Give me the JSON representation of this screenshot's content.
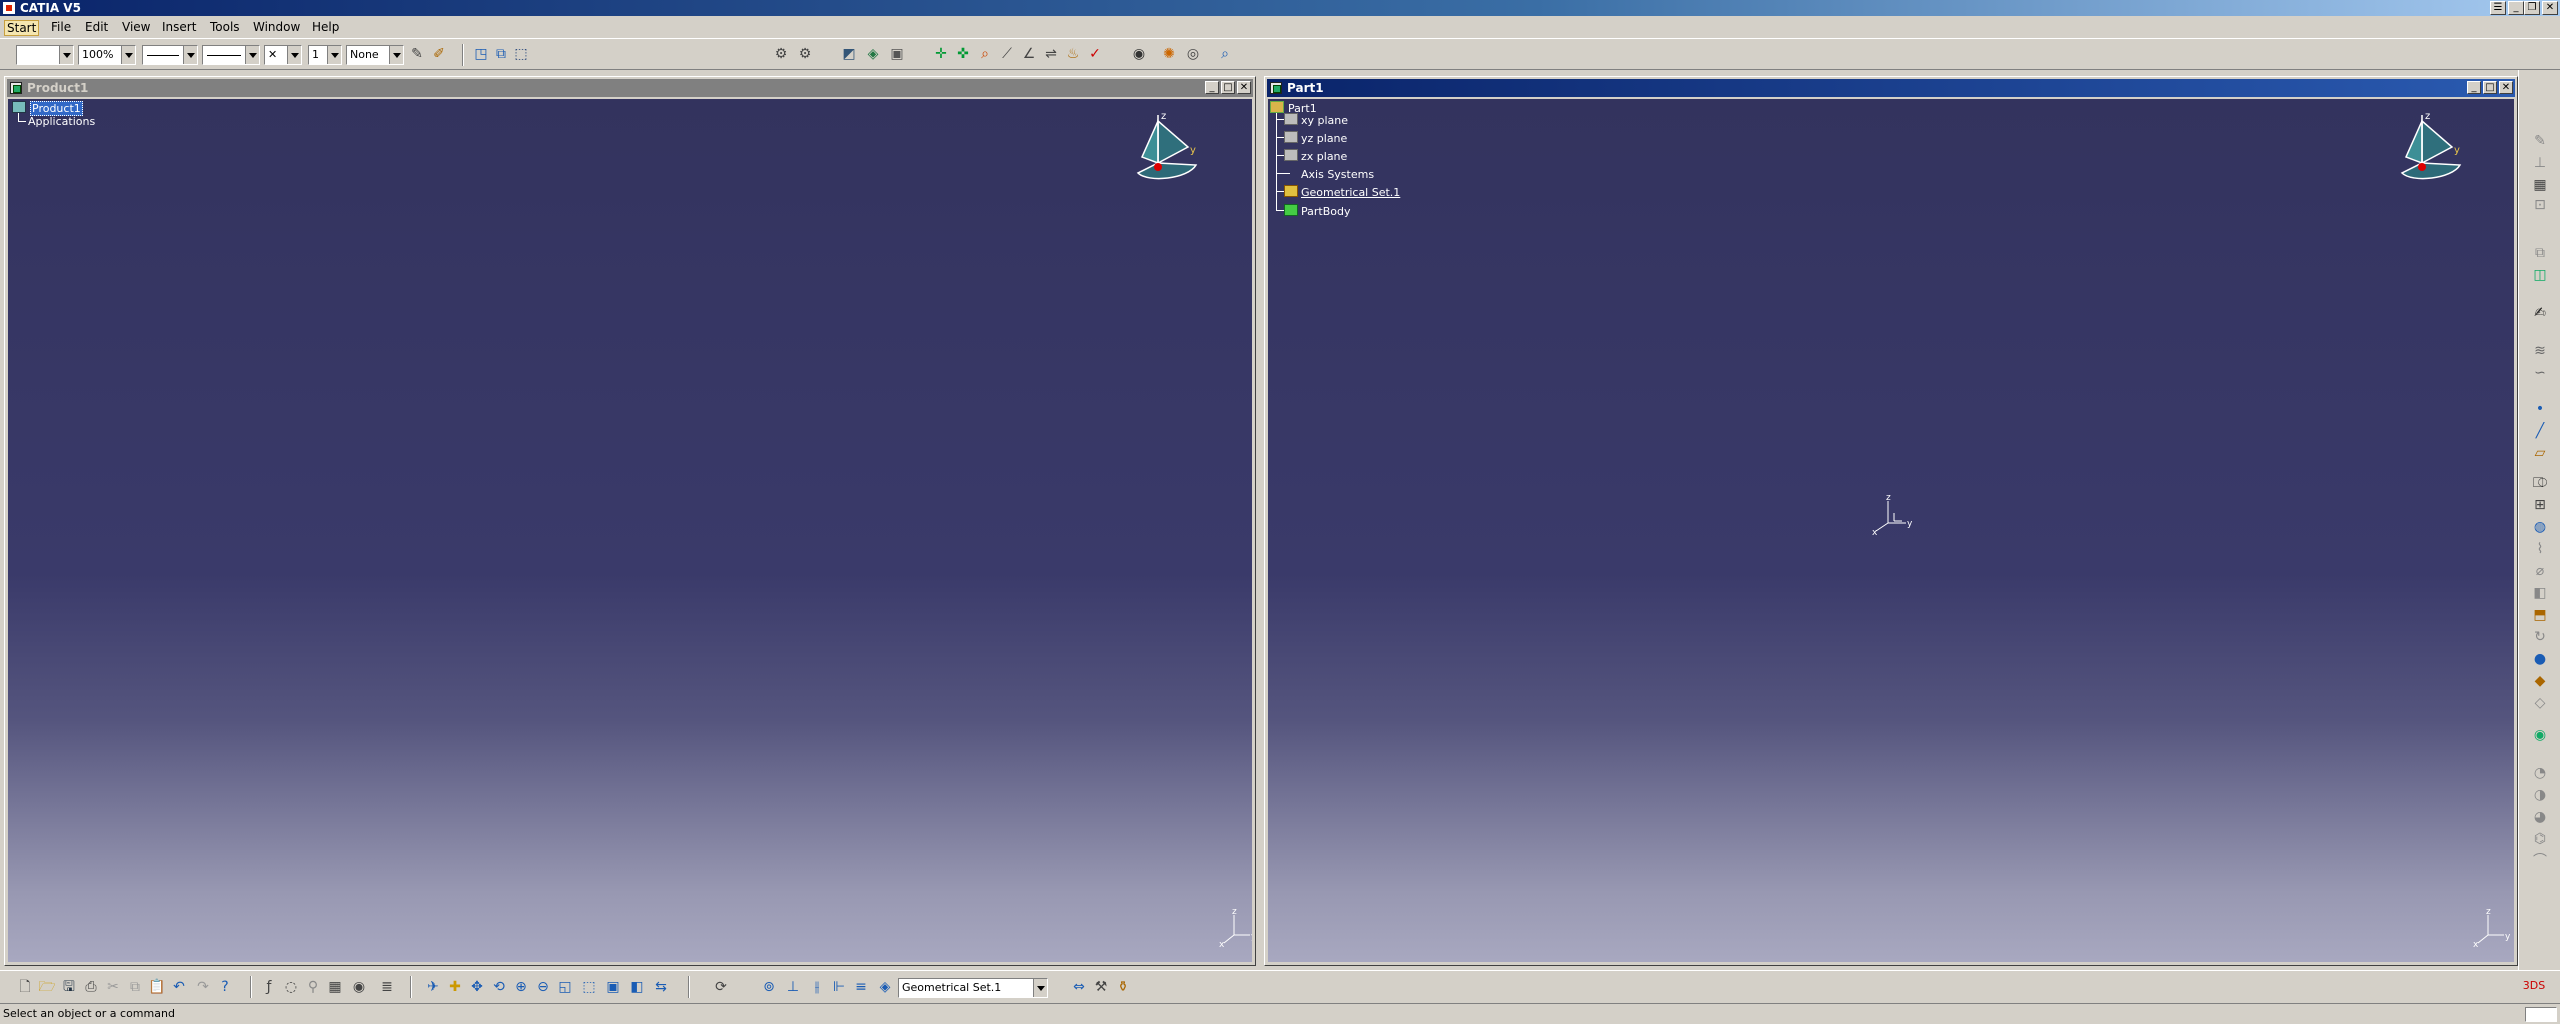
{
  "app": {
    "title": "CATIA V5"
  },
  "menu": {
    "items": [
      "Start",
      "File",
      "Edit",
      "View",
      "Insert",
      "Tools",
      "Window",
      "Help"
    ]
  },
  "toolbar": {
    "zoom": "100%",
    "layer": "None",
    "thickness": "1"
  },
  "windows": {
    "product": {
      "title": "Product1",
      "tree": {
        "root": "Product1",
        "children": [
          "Applications"
        ]
      }
    },
    "part": {
      "title": "Part1",
      "tree": {
        "root": "Part1",
        "children": [
          "xy plane",
          "yz plane",
          "zx plane",
          "Axis Systems",
          "Geometrical Set.1",
          "PartBody"
        ]
      }
    }
  },
  "compass": {
    "z": "z",
    "y": "y"
  },
  "axes": {
    "x": "x",
    "y": "y",
    "z": "z"
  },
  "bottom_toolbar": {
    "current_set": "Geometrical Set.1"
  },
  "status": {
    "message": "Select an object or a command"
  },
  "colors": {
    "viewport_top": "#33335e",
    "viewport_bottom": "#a8a8c0",
    "selection": "#3168c6"
  }
}
